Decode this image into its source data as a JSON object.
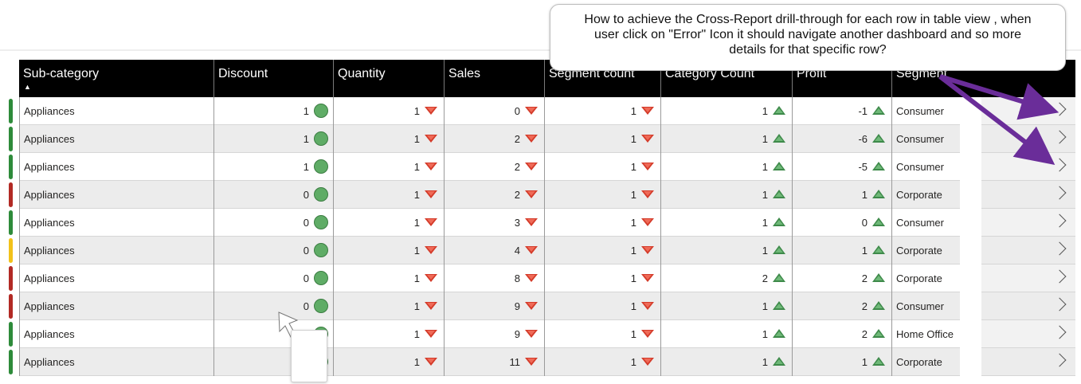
{
  "table": {
    "columns": [
      "Sub-category",
      "Discount",
      "Quantity",
      "Sales",
      "Segment count",
      "Category Count",
      "Profit",
      "Segment"
    ],
    "sort_indicator": "▲",
    "rows": [
      {
        "sub_category": "Appliances",
        "discount": "1",
        "quantity": "1",
        "sales": "0",
        "segment_count": "1",
        "category_count": "1",
        "profit": "-1",
        "segment": "Consumer",
        "status_color": "#2e8b3a"
      },
      {
        "sub_category": "Appliances",
        "discount": "1",
        "quantity": "1",
        "sales": "2",
        "segment_count": "1",
        "category_count": "1",
        "profit": "-6",
        "segment": "Consumer",
        "status_color": "#2e8b3a"
      },
      {
        "sub_category": "Appliances",
        "discount": "1",
        "quantity": "1",
        "sales": "2",
        "segment_count": "1",
        "category_count": "1",
        "profit": "-5",
        "segment": "Consumer",
        "status_color": "#2e8b3a"
      },
      {
        "sub_category": "Appliances",
        "discount": "0",
        "quantity": "1",
        "sales": "2",
        "segment_count": "1",
        "category_count": "1",
        "profit": "1",
        "segment": "Corporate",
        "status_color": "#b22a24"
      },
      {
        "sub_category": "Appliances",
        "discount": "0",
        "quantity": "1",
        "sales": "3",
        "segment_count": "1",
        "category_count": "1",
        "profit": "0",
        "segment": "Consumer",
        "status_color": "#2e8b3a"
      },
      {
        "sub_category": "Appliances",
        "discount": "0",
        "quantity": "1",
        "sales": "4",
        "segment_count": "1",
        "category_count": "1",
        "profit": "1",
        "segment": "Corporate",
        "status_color": "#f2c21a"
      },
      {
        "sub_category": "Appliances",
        "discount": "0",
        "quantity": "1",
        "sales": "8",
        "segment_count": "1",
        "category_count": "2",
        "profit": "2",
        "segment": "Corporate",
        "status_color": "#b22a24"
      },
      {
        "sub_category": "Appliances",
        "discount": "0",
        "quantity": "1",
        "sales": "9",
        "segment_count": "1",
        "category_count": "1",
        "profit": "2",
        "segment": "Consumer",
        "status_color": "#b22a24"
      },
      {
        "sub_category": "Appliances",
        "discount": "",
        "quantity": "1",
        "sales": "9",
        "segment_count": "1",
        "category_count": "1",
        "profit": "2",
        "segment": "Home Office",
        "status_color": "#2e8b3a"
      },
      {
        "sub_category": "Appliances",
        "discount": "",
        "quantity": "1",
        "sales": "11",
        "segment_count": "1",
        "category_count": "1",
        "profit": "1",
        "segment": "Corporate",
        "status_color": "#2e8b3a"
      }
    ]
  },
  "callout": {
    "text": "How to achieve the Cross-Report drill-through for each row in table view , when user click on \"Error\" Icon it should navigate another dashboard and so more details for that specific row?"
  },
  "colors": {
    "header_bg": "#000000",
    "arrow": "#6a2d99",
    "up_icon": "#3e8a4a",
    "down_icon": "#d43b2a",
    "circle_icon": "#5fac66"
  },
  "icons": {
    "discount": "green-circle-icon",
    "quantity": "red-triangle-down-icon",
    "sales": "red-triangle-down-icon",
    "segment_count": "red-triangle-down-icon",
    "category_count": "green-triangle-up-icon",
    "profit": "green-triangle-up-icon",
    "drillthrough": "chevron-right-icon"
  }
}
